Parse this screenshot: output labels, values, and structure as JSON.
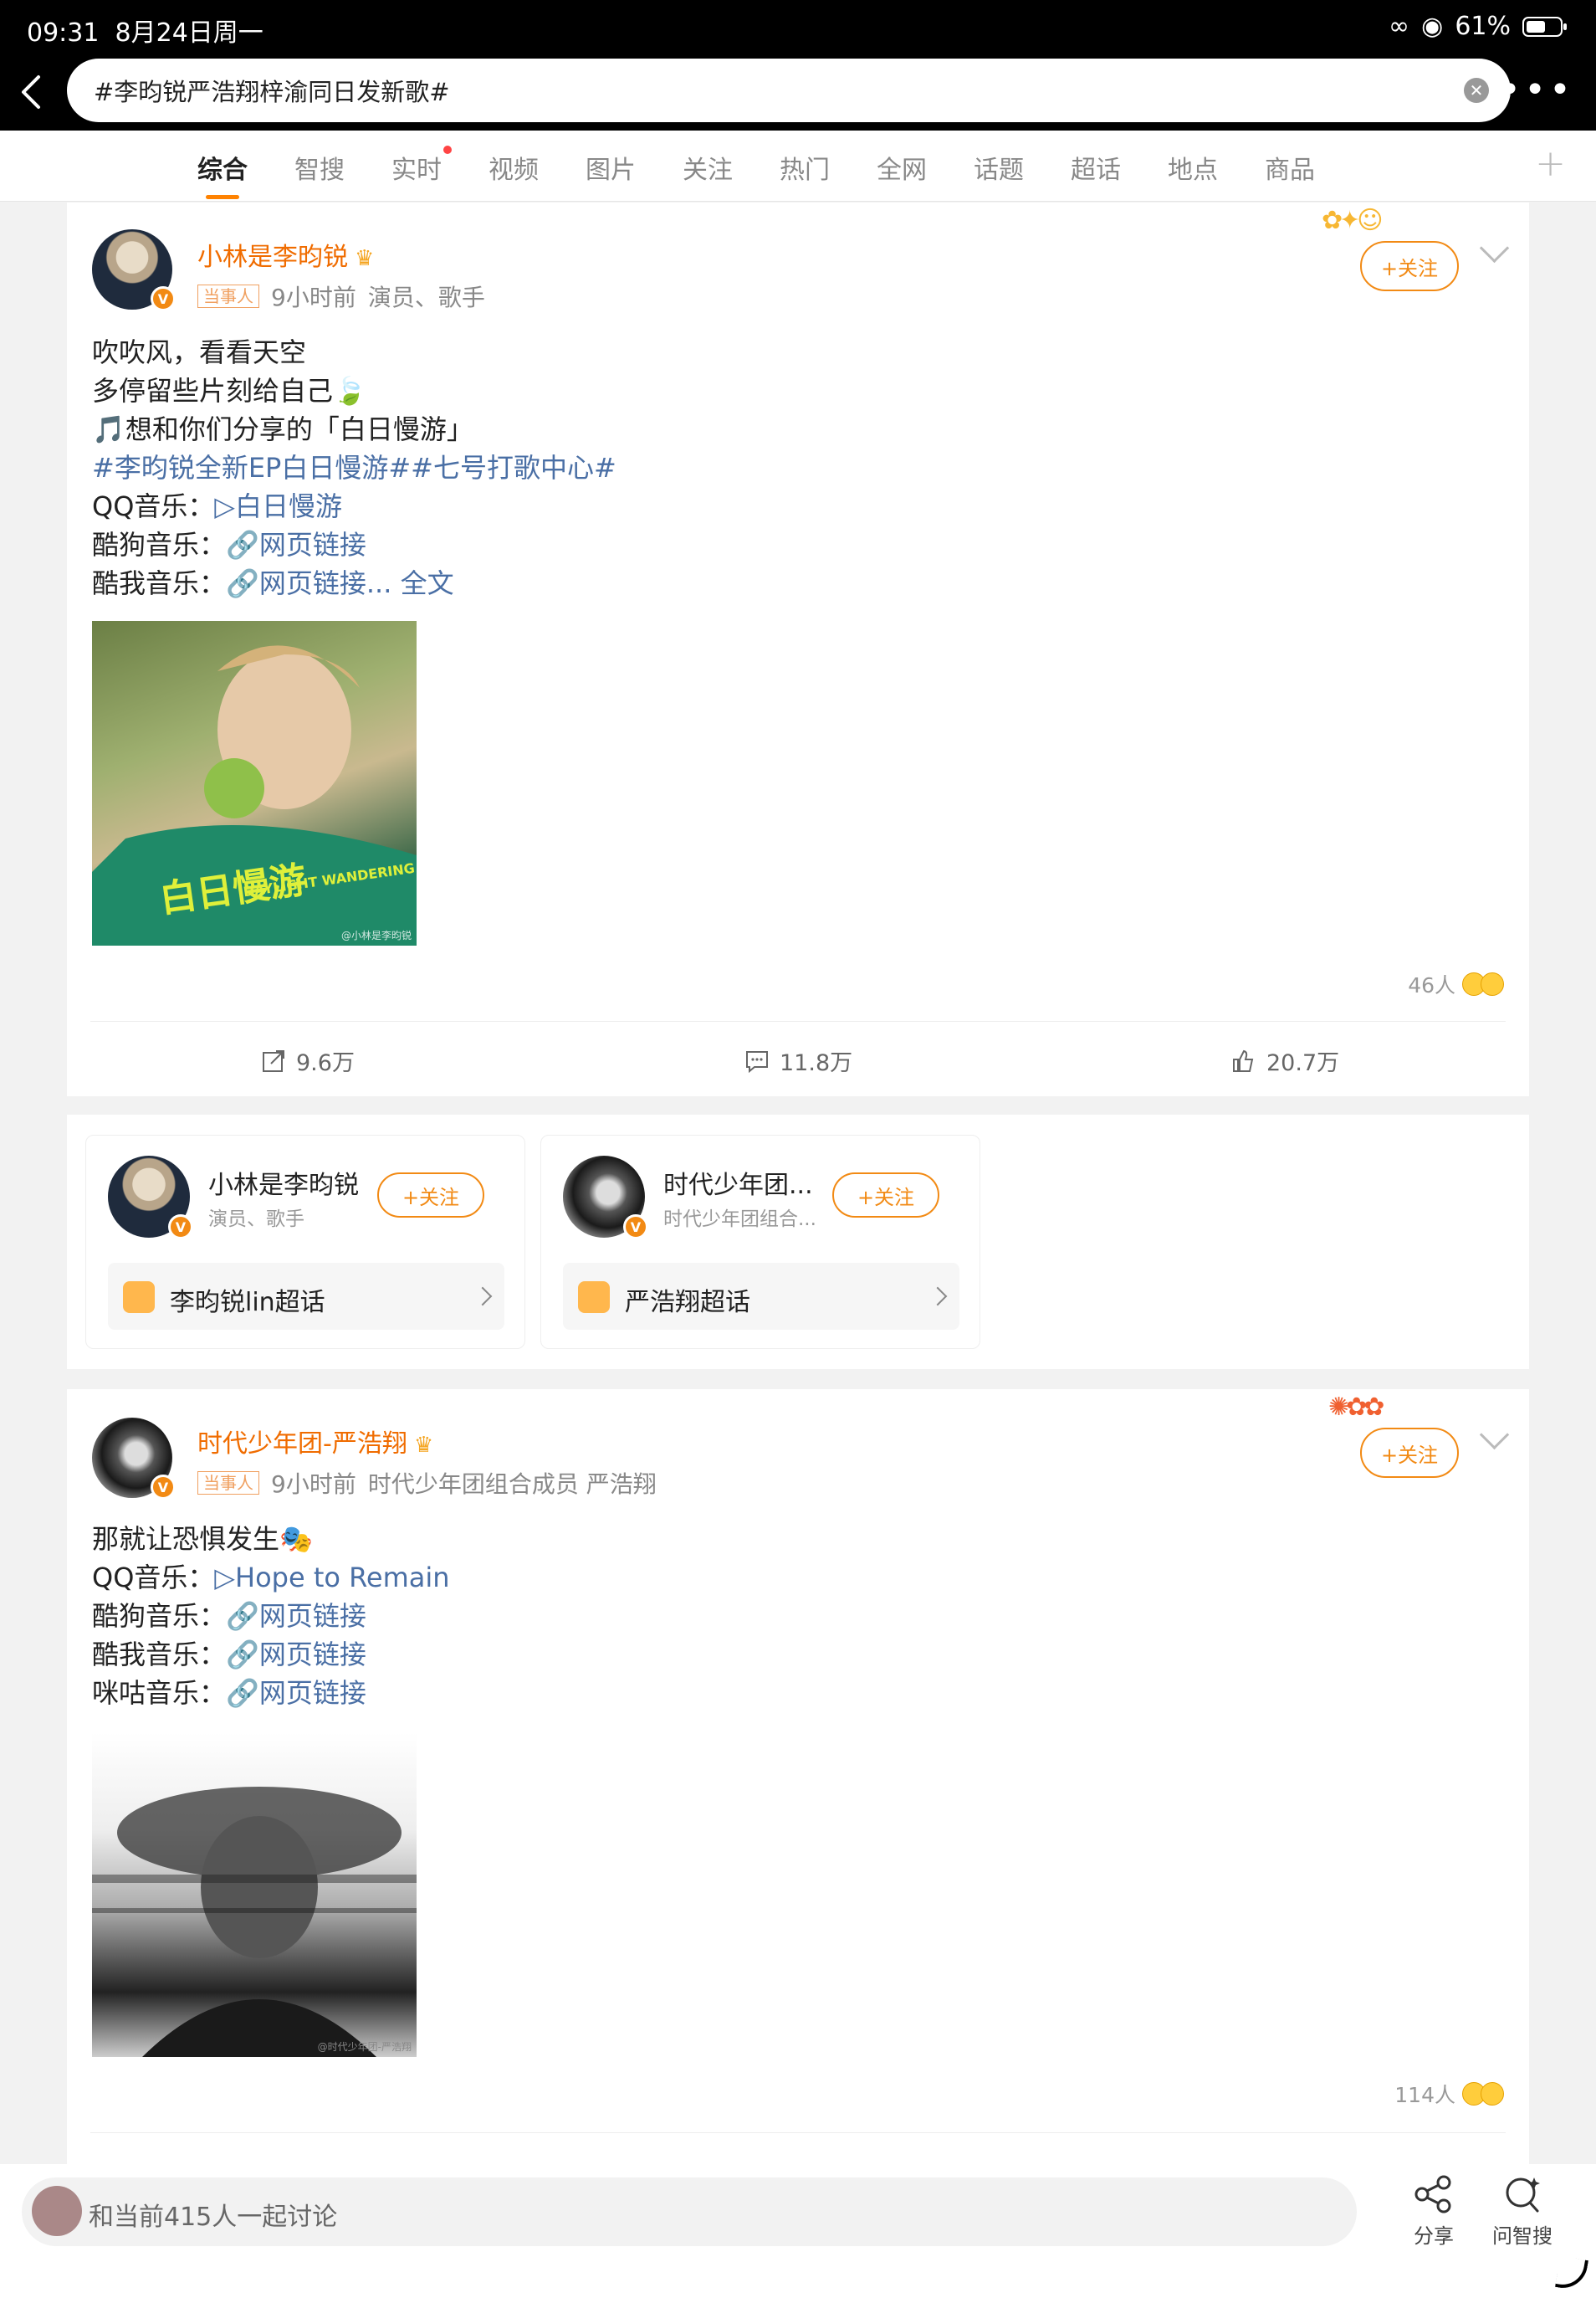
{
  "status": {
    "time": "09:31",
    "date": "8月24日周一",
    "battery": "61%"
  },
  "search": {
    "query": "#李昀锐严浩翔梓渝同日发新歌#"
  },
  "tabs": [
    "综合",
    "智搜",
    "实时",
    "视频",
    "图片",
    "关注",
    "热门",
    "全网",
    "话题",
    "超话",
    "地点",
    "商品"
  ],
  "post1": {
    "user": "小林是李昀锐",
    "tag": "当事人",
    "time": "9小时前",
    "desc": "演员、歌手",
    "follow": "+关注",
    "lines": [
      "吹吹风，看看天空",
      "多停留些片刻给自己🍃",
      "🎵想和你们分享的「白日慢游」"
    ],
    "hashtags": "#李昀锐全新EP白日慢游##七号打歌中心#",
    "qq_label": "QQ音乐：",
    "qq_link": "▷白日慢游",
    "kugou_label": "酷狗音乐：",
    "kugou_link": "🔗网页链接",
    "kuwo_label": "酷我音乐：",
    "kuwo_link": "🔗网页链接...",
    "full": "全文",
    "photo_text": "白日慢游",
    "photo_sub": "DAYLIGHT WANDERING",
    "photo_wm": "@小林是李昀锐",
    "reactors": "46人",
    "reposts": "9.6万",
    "comments": "11.8万",
    "likes": "20.7万"
  },
  "accounts": [
    {
      "name": "小林是李昀锐",
      "sub": "演员、歌手",
      "follow": "+关注",
      "super": "李昀锐lin超话"
    },
    {
      "name": "时代少年团...",
      "sub": "时代少年团组合...",
      "follow": "+关注",
      "super": "严浩翔超话"
    }
  ],
  "post2": {
    "user": "时代少年团-严浩翔",
    "tag": "当事人",
    "time": "9小时前",
    "desc": "时代少年团组合成员 严浩翔",
    "follow": "+关注",
    "line1": "那就让恐惧发生🎭",
    "qq_label": "QQ音乐：",
    "qq_link": "▷Hope to Remain",
    "kugou_label": "酷狗音乐：",
    "kugou_link": "🔗网页链接",
    "kuwo_label": "酷我音乐：",
    "kuwo_link": "🔗网页链接",
    "migu_label": "咪咕音乐：",
    "migu_link": "🔗网页链接",
    "photo_wm": "@时代少年团-严浩翔",
    "reactors": "114人"
  },
  "bottom": {
    "placeholder": "和当前415人一起讨论",
    "share": "分享",
    "ask": "问智搜"
  }
}
